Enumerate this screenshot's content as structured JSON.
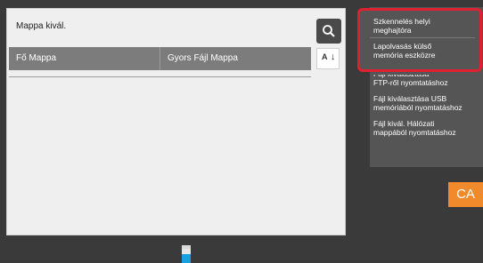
{
  "panel": {
    "title": "Mappa kivál."
  },
  "folder_bar": {
    "items": [
      {
        "label": "Fő Mappa"
      },
      {
        "label": "Gyors Fájl Mappa"
      }
    ]
  },
  "right_menu": {
    "items": [
      {
        "label_line1": "Szkennelés helyi",
        "label_line2": "meghajtóra"
      },
      {
        "label_line1": "Lapolvasás külső",
        "label_line2": "memória eszközre"
      },
      {
        "label_line1": "Fájl kiválasztása",
        "label_line2": "FTP-ről nyomtatáshoz"
      },
      {
        "label_line1": "Fájl kiválasztása USB",
        "label_line2": "memóriából nyomtatáshoz"
      },
      {
        "label_line1": "Fájl kivál. Hálózati",
        "label_line2": "mappából nyomtatáshoz"
      }
    ]
  },
  "ca_button": {
    "label": "CA"
  },
  "colors": {
    "highlight": "#e02030",
    "ca_orange": "#f08a2a",
    "folder_bar": "#7c7c7c"
  },
  "icons": {
    "search": "search-icon",
    "sort": "sort-az-icon",
    "toner": "toner-cartridge-icon"
  }
}
